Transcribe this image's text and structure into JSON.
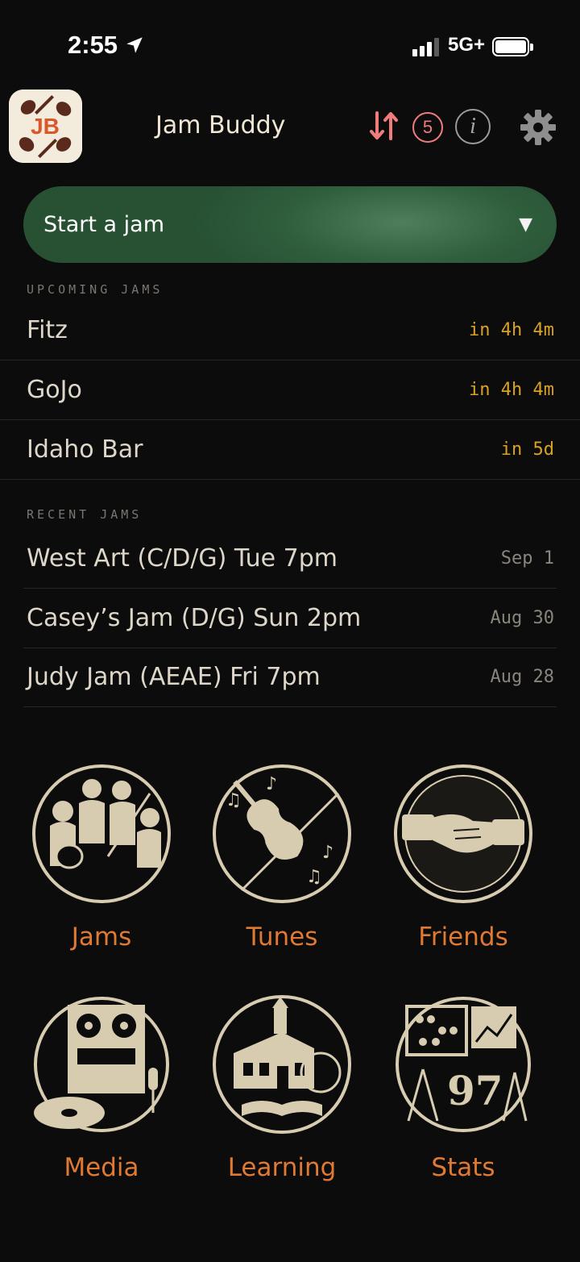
{
  "status_bar": {
    "time": "2:55",
    "network": "5G+"
  },
  "header": {
    "title": "Jam Buddy",
    "app_icon_text": "JB",
    "notification_count": "5",
    "info_glyph": "i"
  },
  "start_jam": {
    "label": "Start a jam",
    "caret": "▼"
  },
  "upcoming": {
    "heading": "UPCOMING JAMS",
    "items": [
      {
        "name": "Fitz",
        "when": "in 4h 4m"
      },
      {
        "name": "GoJo",
        "when": "in 4h 4m"
      },
      {
        "name": "Idaho Bar",
        "when": "in 5d"
      }
    ]
  },
  "recent": {
    "heading": "RECENT JAMS",
    "items": [
      {
        "name": "West Art (C/D/G) Tue 7pm",
        "date": "Sep 1"
      },
      {
        "name": "Casey’s Jam (D/G) Sun 2pm",
        "date": "Aug 30"
      },
      {
        "name": "Judy Jam (AEAE) Fri 7pm",
        "date": "Aug 28"
      }
    ]
  },
  "tiles": [
    {
      "label": "Jams",
      "icon": "jam-musicians-icon"
    },
    {
      "label": "Tunes",
      "icon": "fiddle-icon"
    },
    {
      "label": "Friends",
      "icon": "handshake-icon"
    },
    {
      "label": "Media",
      "icon": "tape-recorder-icon"
    },
    {
      "label": "Learning",
      "icon": "schoolhouse-icon"
    },
    {
      "label": "Stats",
      "icon": "abacus-chart-icon"
    }
  ],
  "colors": {
    "accent": "#e07a33",
    "highlight": "#d8a227",
    "green": "#2f5f3d",
    "alert": "#f07c7c"
  }
}
